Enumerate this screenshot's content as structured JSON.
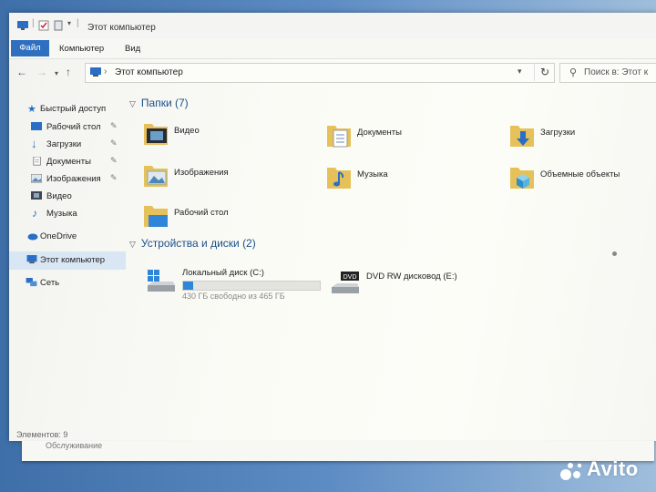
{
  "window": {
    "title": "Этот компьютер"
  },
  "ribbon": {
    "tabs": [
      "Файл",
      "Компьютер",
      "Вид"
    ]
  },
  "address": {
    "path": "Этот компьютер"
  },
  "search": {
    "placeholder": "Поиск в: Этот к"
  },
  "sidebar": {
    "items": [
      {
        "label": "Быстрый доступ",
        "icon": "star-icon"
      },
      {
        "label": "Рабочий стол",
        "icon": "desktop-icon",
        "pinned": true
      },
      {
        "label": "Загрузки",
        "icon": "download-arrow-icon",
        "pinned": true
      },
      {
        "label": "Документы",
        "icon": "document-icon",
        "pinned": true
      },
      {
        "label": "Изображения",
        "icon": "pictures-icon",
        "pinned": true
      },
      {
        "label": "Видео",
        "icon": "video-icon"
      },
      {
        "label": "Музыка",
        "icon": "music-note-icon"
      },
      {
        "label": "OneDrive",
        "icon": "cloud-icon"
      },
      {
        "label": "Этот компьютер",
        "icon": "computer-icon",
        "selected": true
      },
      {
        "label": "Сеть",
        "icon": "network-icon"
      }
    ]
  },
  "folders_group": {
    "title": "Папки (7)"
  },
  "folders": [
    {
      "name": "Видео",
      "icon": "video-folder-icon"
    },
    {
      "name": "Документы",
      "icon": "documents-folder-icon"
    },
    {
      "name": "Загрузки",
      "icon": "downloads-folder-icon"
    },
    {
      "name": "Изображения",
      "icon": "pictures-folder-icon"
    },
    {
      "name": "Музыка",
      "icon": "music-folder-icon"
    },
    {
      "name": "Объемные объекты",
      "icon": "3d-objects-folder-icon"
    },
    {
      "name": "Рабочий стол",
      "icon": "desktop-folder-icon"
    }
  ],
  "devices_group": {
    "title": "Устройства и диски (2)"
  },
  "drives": [
    {
      "name": "Локальный диск (C:)",
      "free": "430 ГБ свободно из 465 ГБ",
      "used_fraction": 0.075,
      "icon": "windows-drive-icon"
    },
    {
      "name": "DVD RW дисковод (E:)",
      "icon": "dvd-drive-icon",
      "badge": "DVD"
    }
  ],
  "status": {
    "items": "Элементов: 9"
  },
  "background_window": {
    "text": "Обслуживание"
  },
  "watermark": {
    "text": "Avito"
  },
  "colors": {
    "accent": "#2f6fc0",
    "selection": "#d9e6f4",
    "group_header": "#1e4f8a",
    "progress": "#2f86d8"
  }
}
